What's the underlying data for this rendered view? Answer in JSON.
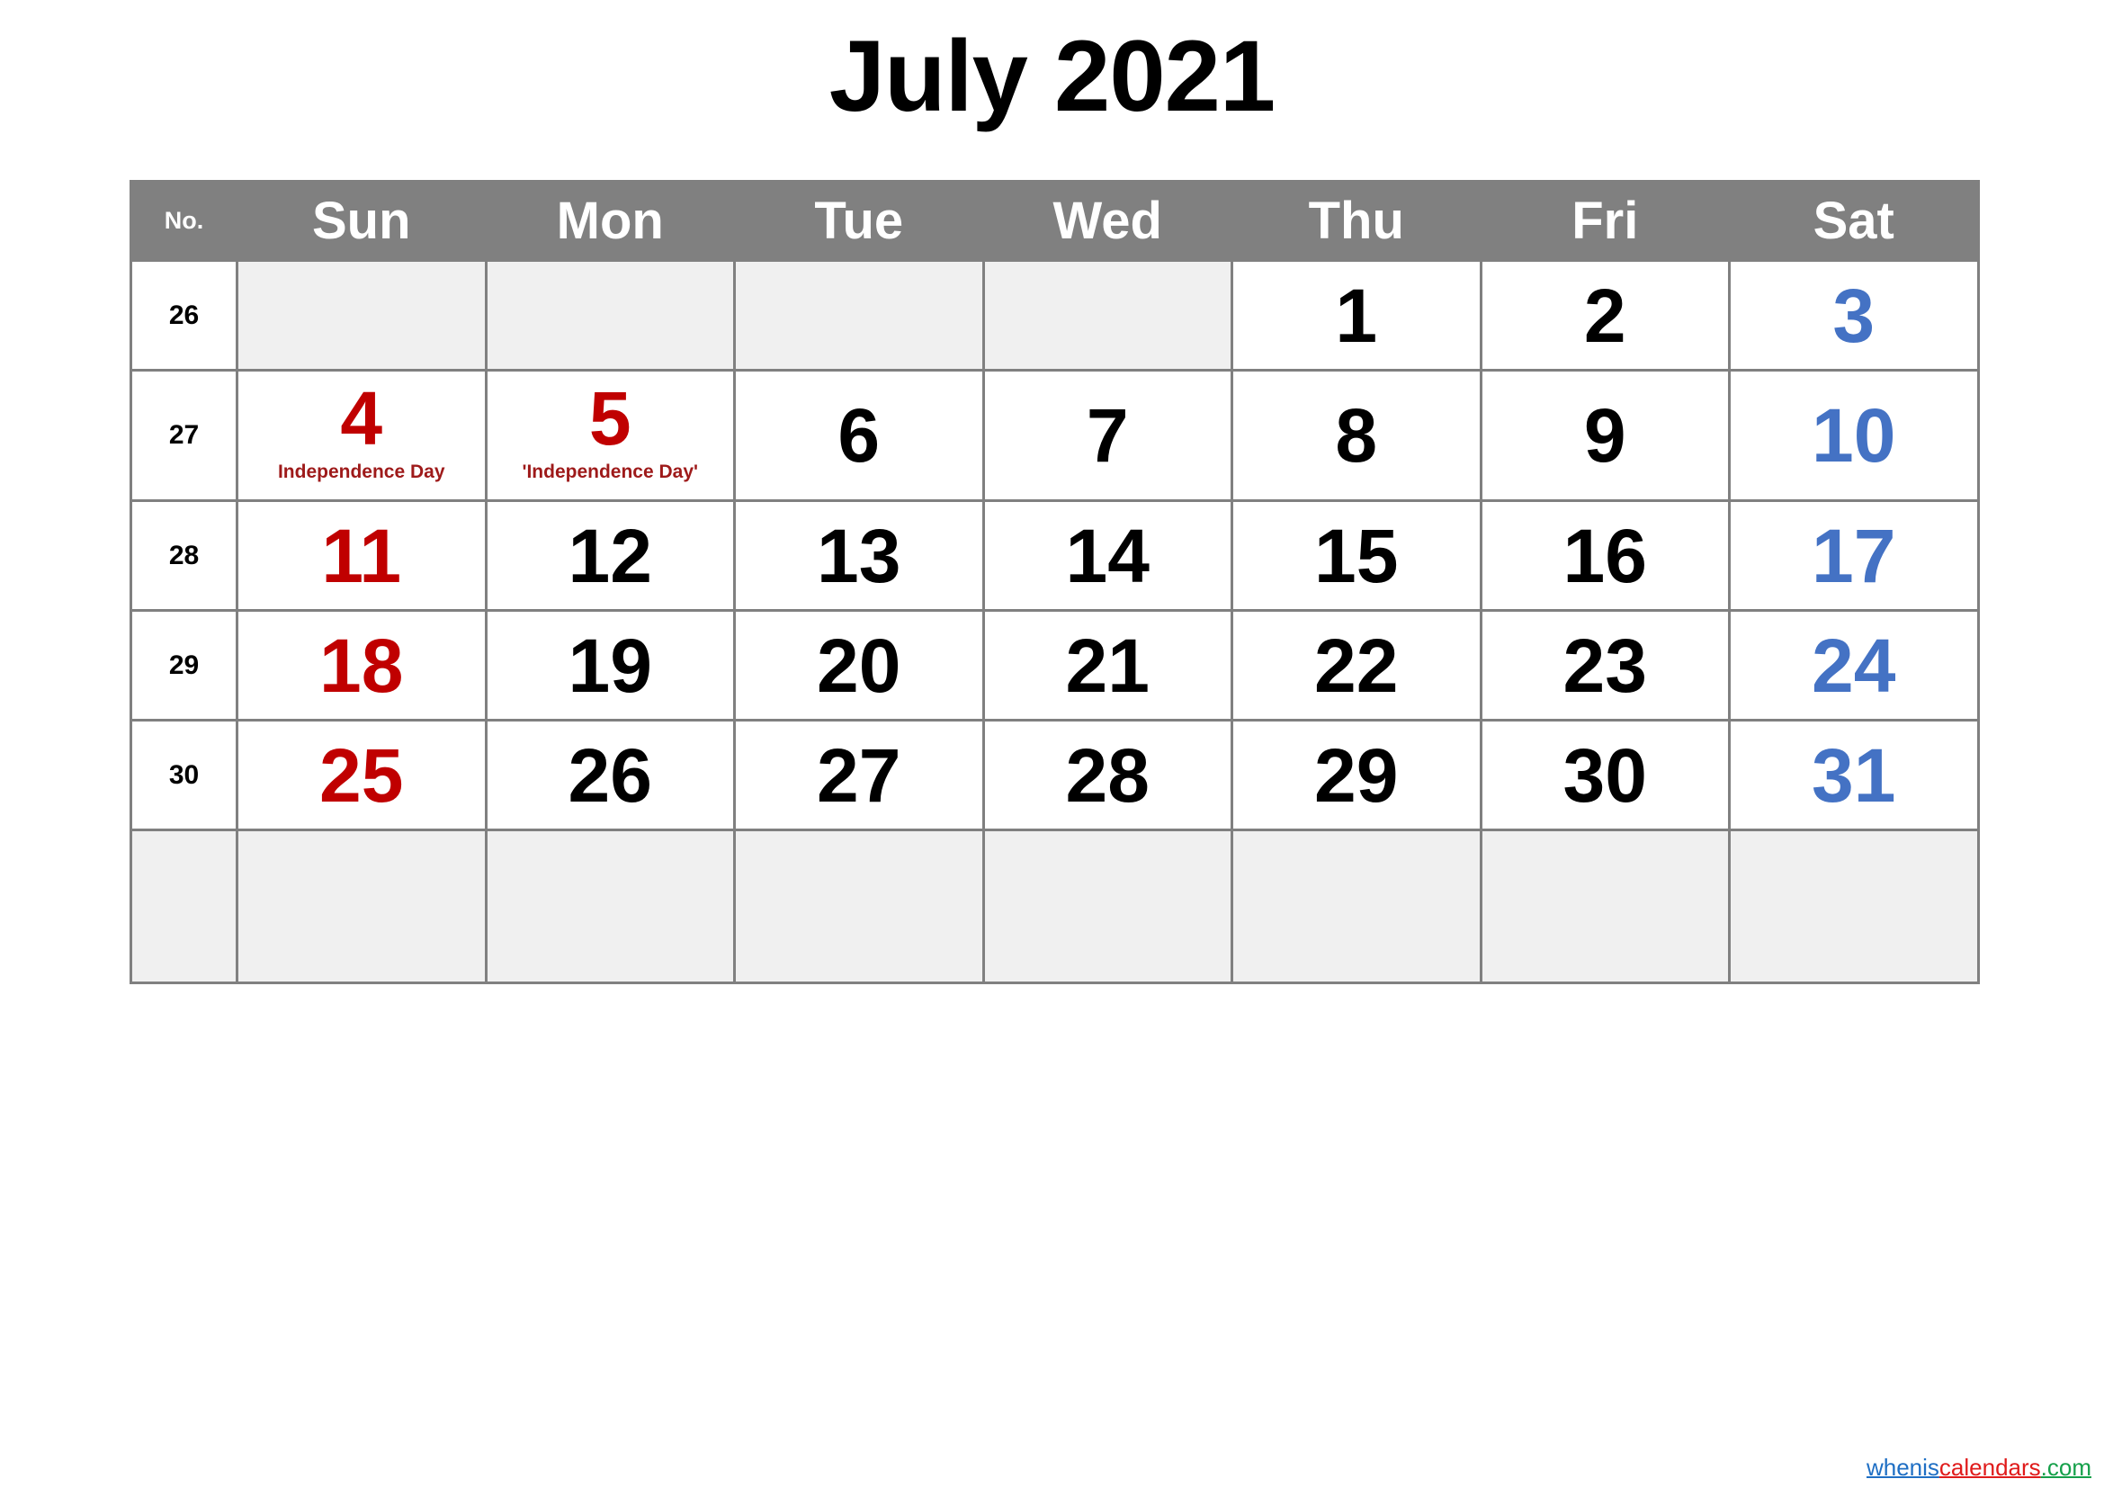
{
  "title": "July 2021",
  "colors": {
    "header_bg": "#808080",
    "header_text": "#ffffff",
    "grid_line": "#808080",
    "blank_cell_bg": "#f0f0f0",
    "sunday": "#c00000",
    "saturday": "#4472c4",
    "weekday": "#000000",
    "holiday_label": "#9e1a1a"
  },
  "header": {
    "week_no_label": "No.",
    "days": [
      "Sun",
      "Mon",
      "Tue",
      "Wed",
      "Thu",
      "Fri",
      "Sat"
    ]
  },
  "weeks": [
    {
      "no": "26",
      "cells": [
        {
          "day": "",
          "kind": "blank"
        },
        {
          "day": "",
          "kind": "blank"
        },
        {
          "day": "",
          "kind": "blank"
        },
        {
          "day": "",
          "kind": "blank"
        },
        {
          "day": "1",
          "kind": "weekday"
        },
        {
          "day": "2",
          "kind": "weekday"
        },
        {
          "day": "3",
          "kind": "saturday"
        }
      ]
    },
    {
      "no": "27",
      "cells": [
        {
          "day": "4",
          "kind": "holiday",
          "holiday": "Independence Day"
        },
        {
          "day": "5",
          "kind": "holiday",
          "holiday": "'Independence Day'"
        },
        {
          "day": "6",
          "kind": "weekday"
        },
        {
          "day": "7",
          "kind": "weekday"
        },
        {
          "day": "8",
          "kind": "weekday"
        },
        {
          "day": "9",
          "kind": "weekday"
        },
        {
          "day": "10",
          "kind": "saturday"
        }
      ]
    },
    {
      "no": "28",
      "cells": [
        {
          "day": "11",
          "kind": "sunday"
        },
        {
          "day": "12",
          "kind": "weekday"
        },
        {
          "day": "13",
          "kind": "weekday"
        },
        {
          "day": "14",
          "kind": "weekday"
        },
        {
          "day": "15",
          "kind": "weekday"
        },
        {
          "day": "16",
          "kind": "weekday"
        },
        {
          "day": "17",
          "kind": "saturday"
        }
      ]
    },
    {
      "no": "29",
      "cells": [
        {
          "day": "18",
          "kind": "sunday"
        },
        {
          "day": "19",
          "kind": "weekday"
        },
        {
          "day": "20",
          "kind": "weekday"
        },
        {
          "day": "21",
          "kind": "weekday"
        },
        {
          "day": "22",
          "kind": "weekday"
        },
        {
          "day": "23",
          "kind": "weekday"
        },
        {
          "day": "24",
          "kind": "saturday"
        }
      ]
    },
    {
      "no": "30",
      "cells": [
        {
          "day": "25",
          "kind": "sunday"
        },
        {
          "day": "26",
          "kind": "weekday"
        },
        {
          "day": "27",
          "kind": "weekday"
        },
        {
          "day": "28",
          "kind": "weekday"
        },
        {
          "day": "29",
          "kind": "weekday"
        },
        {
          "day": "30",
          "kind": "weekday"
        },
        {
          "day": "31",
          "kind": "saturday"
        }
      ]
    },
    {
      "no": "",
      "trailing": true,
      "cells": [
        {
          "day": "",
          "kind": "blank"
        },
        {
          "day": "",
          "kind": "blank"
        },
        {
          "day": "",
          "kind": "blank"
        },
        {
          "day": "",
          "kind": "blank"
        },
        {
          "day": "",
          "kind": "blank"
        },
        {
          "day": "",
          "kind": "blank"
        },
        {
          "day": "",
          "kind": "blank"
        }
      ]
    }
  ],
  "watermark": {
    "part1": "whenis",
    "part2": "calendars",
    "part3": ".com"
  }
}
